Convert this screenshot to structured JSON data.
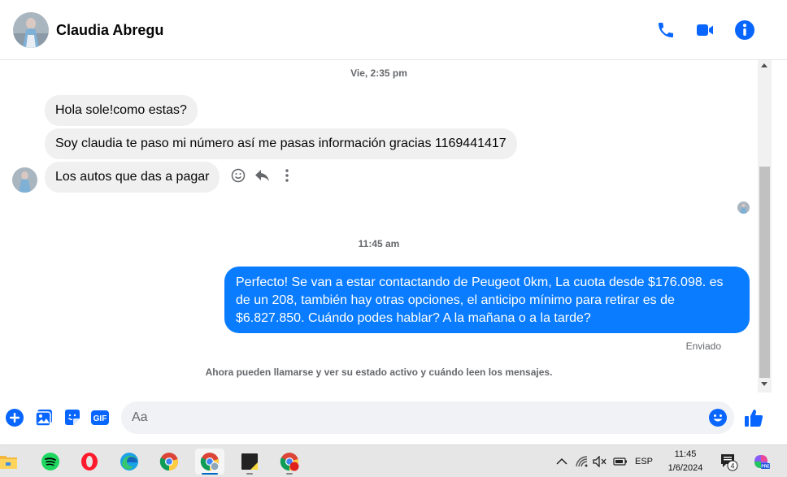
{
  "header": {
    "contact_name": "Claudia Abregu",
    "icons": [
      "phone-icon",
      "video-camera-icon",
      "info-icon"
    ]
  },
  "conversation": {
    "timestamp_1": "Vie, 2:35 pm",
    "incoming": [
      "Hola sole!como estas?",
      "Soy claudia te paso mi número así me pasas información gracias 1169441417",
      "Los autos que das a pagar"
    ],
    "message_actions": [
      "emoji-reaction-icon",
      "reply-icon",
      "more-options-icon"
    ],
    "timestamp_2": "11:45 am",
    "outgoing": "Perfecto!  Se van a estar contactando de Peugeot 0km, La cuota desde $176.098. es de un 208, también hay otras opciones, el anticipo mínimo para retirar es de $6.827.850. Cuándo podes hablar? A la mañana o a la tarde?",
    "status": "Enviado",
    "notice": "Ahora pueden llamarse y ver su estado activo y cuándo leen los mensajes."
  },
  "composer": {
    "placeholder": "Aa",
    "value": ""
  },
  "taskbar": {
    "language": "ESP",
    "time": "11:45",
    "date": "1/6/2024",
    "notification_count": "4"
  },
  "colors": {
    "accent": "#0a7cff",
    "incoming_bubble": "#f0f0f0",
    "icon_blue": "#0866ff"
  }
}
